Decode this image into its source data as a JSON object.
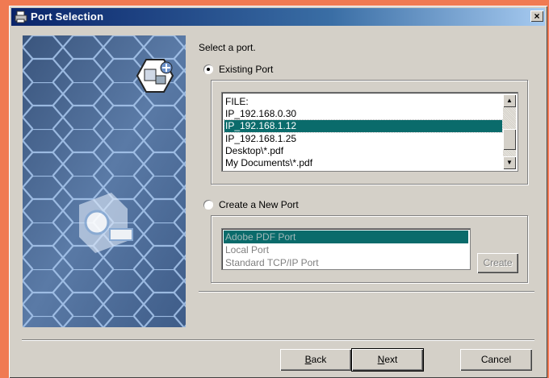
{
  "window": {
    "title": "Port Selection",
    "close_label": "×"
  },
  "prompt": "Select a port.",
  "existing_port": {
    "label": "Existing Port",
    "selected": true,
    "items": [
      "FILE:",
      "IP_192.168.0.30",
      "IP_192.168.1.12",
      "IP_192.168.1.25",
      "Desktop\\*.pdf",
      "My Documents\\*.pdf"
    ],
    "selected_item": "IP_192.168.1.12"
  },
  "new_port": {
    "label": "Create a New Port",
    "selected": false,
    "items": [
      "Adobe PDF Port",
      "Local Port",
      "Standard TCP/IP Port"
    ],
    "selected_item": "Adobe PDF Port",
    "create_label": "Create"
  },
  "buttons": {
    "back_mnemonic": "B",
    "back_rest": "ack",
    "next_mnemonic": "N",
    "next_rest": "ext",
    "cancel": "Cancel"
  },
  "colors": {
    "selection": "#0a6b6b",
    "titlebar": "#0a246a",
    "desktop": "#f07a52",
    "banner": "#4a6890"
  }
}
